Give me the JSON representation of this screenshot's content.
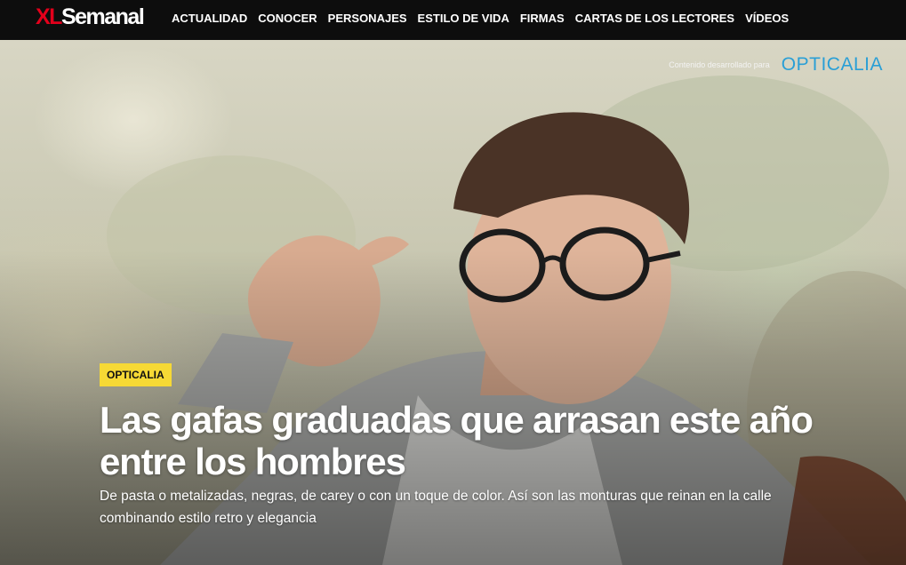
{
  "brand": {
    "logo_xl": "XL",
    "logo_name": "Semanal"
  },
  "nav": {
    "items": [
      {
        "label": "ACTUALIDAD"
      },
      {
        "label": "CONOCER"
      },
      {
        "label": "PERSONAJES"
      },
      {
        "label": "ESTILO DE VIDA"
      },
      {
        "label": "FIRMAS"
      },
      {
        "label": "CARTAS DE LOS LECTORES"
      },
      {
        "label": "VÍDEOS"
      }
    ]
  },
  "sponsor": {
    "text": "Contenido desarrollado para",
    "logo_text": "OPTICALIA",
    "logo_color": "#2a9fd6"
  },
  "article": {
    "tag": "OPTICALIA",
    "headline": "Las gafas graduadas que arrasan este año entre los hombres",
    "dek": "De pasta o metalizadas, negras, de carey o con un toque de color. Así son las monturas que reinan en la calle combinando estilo retro y elegancia",
    "hero_image": "man-wearing-glasses-photo"
  },
  "colors": {
    "brand_red": "#e3001b",
    "nav_background": "#0d0d0d",
    "tag_yellow": "#f6d935"
  }
}
